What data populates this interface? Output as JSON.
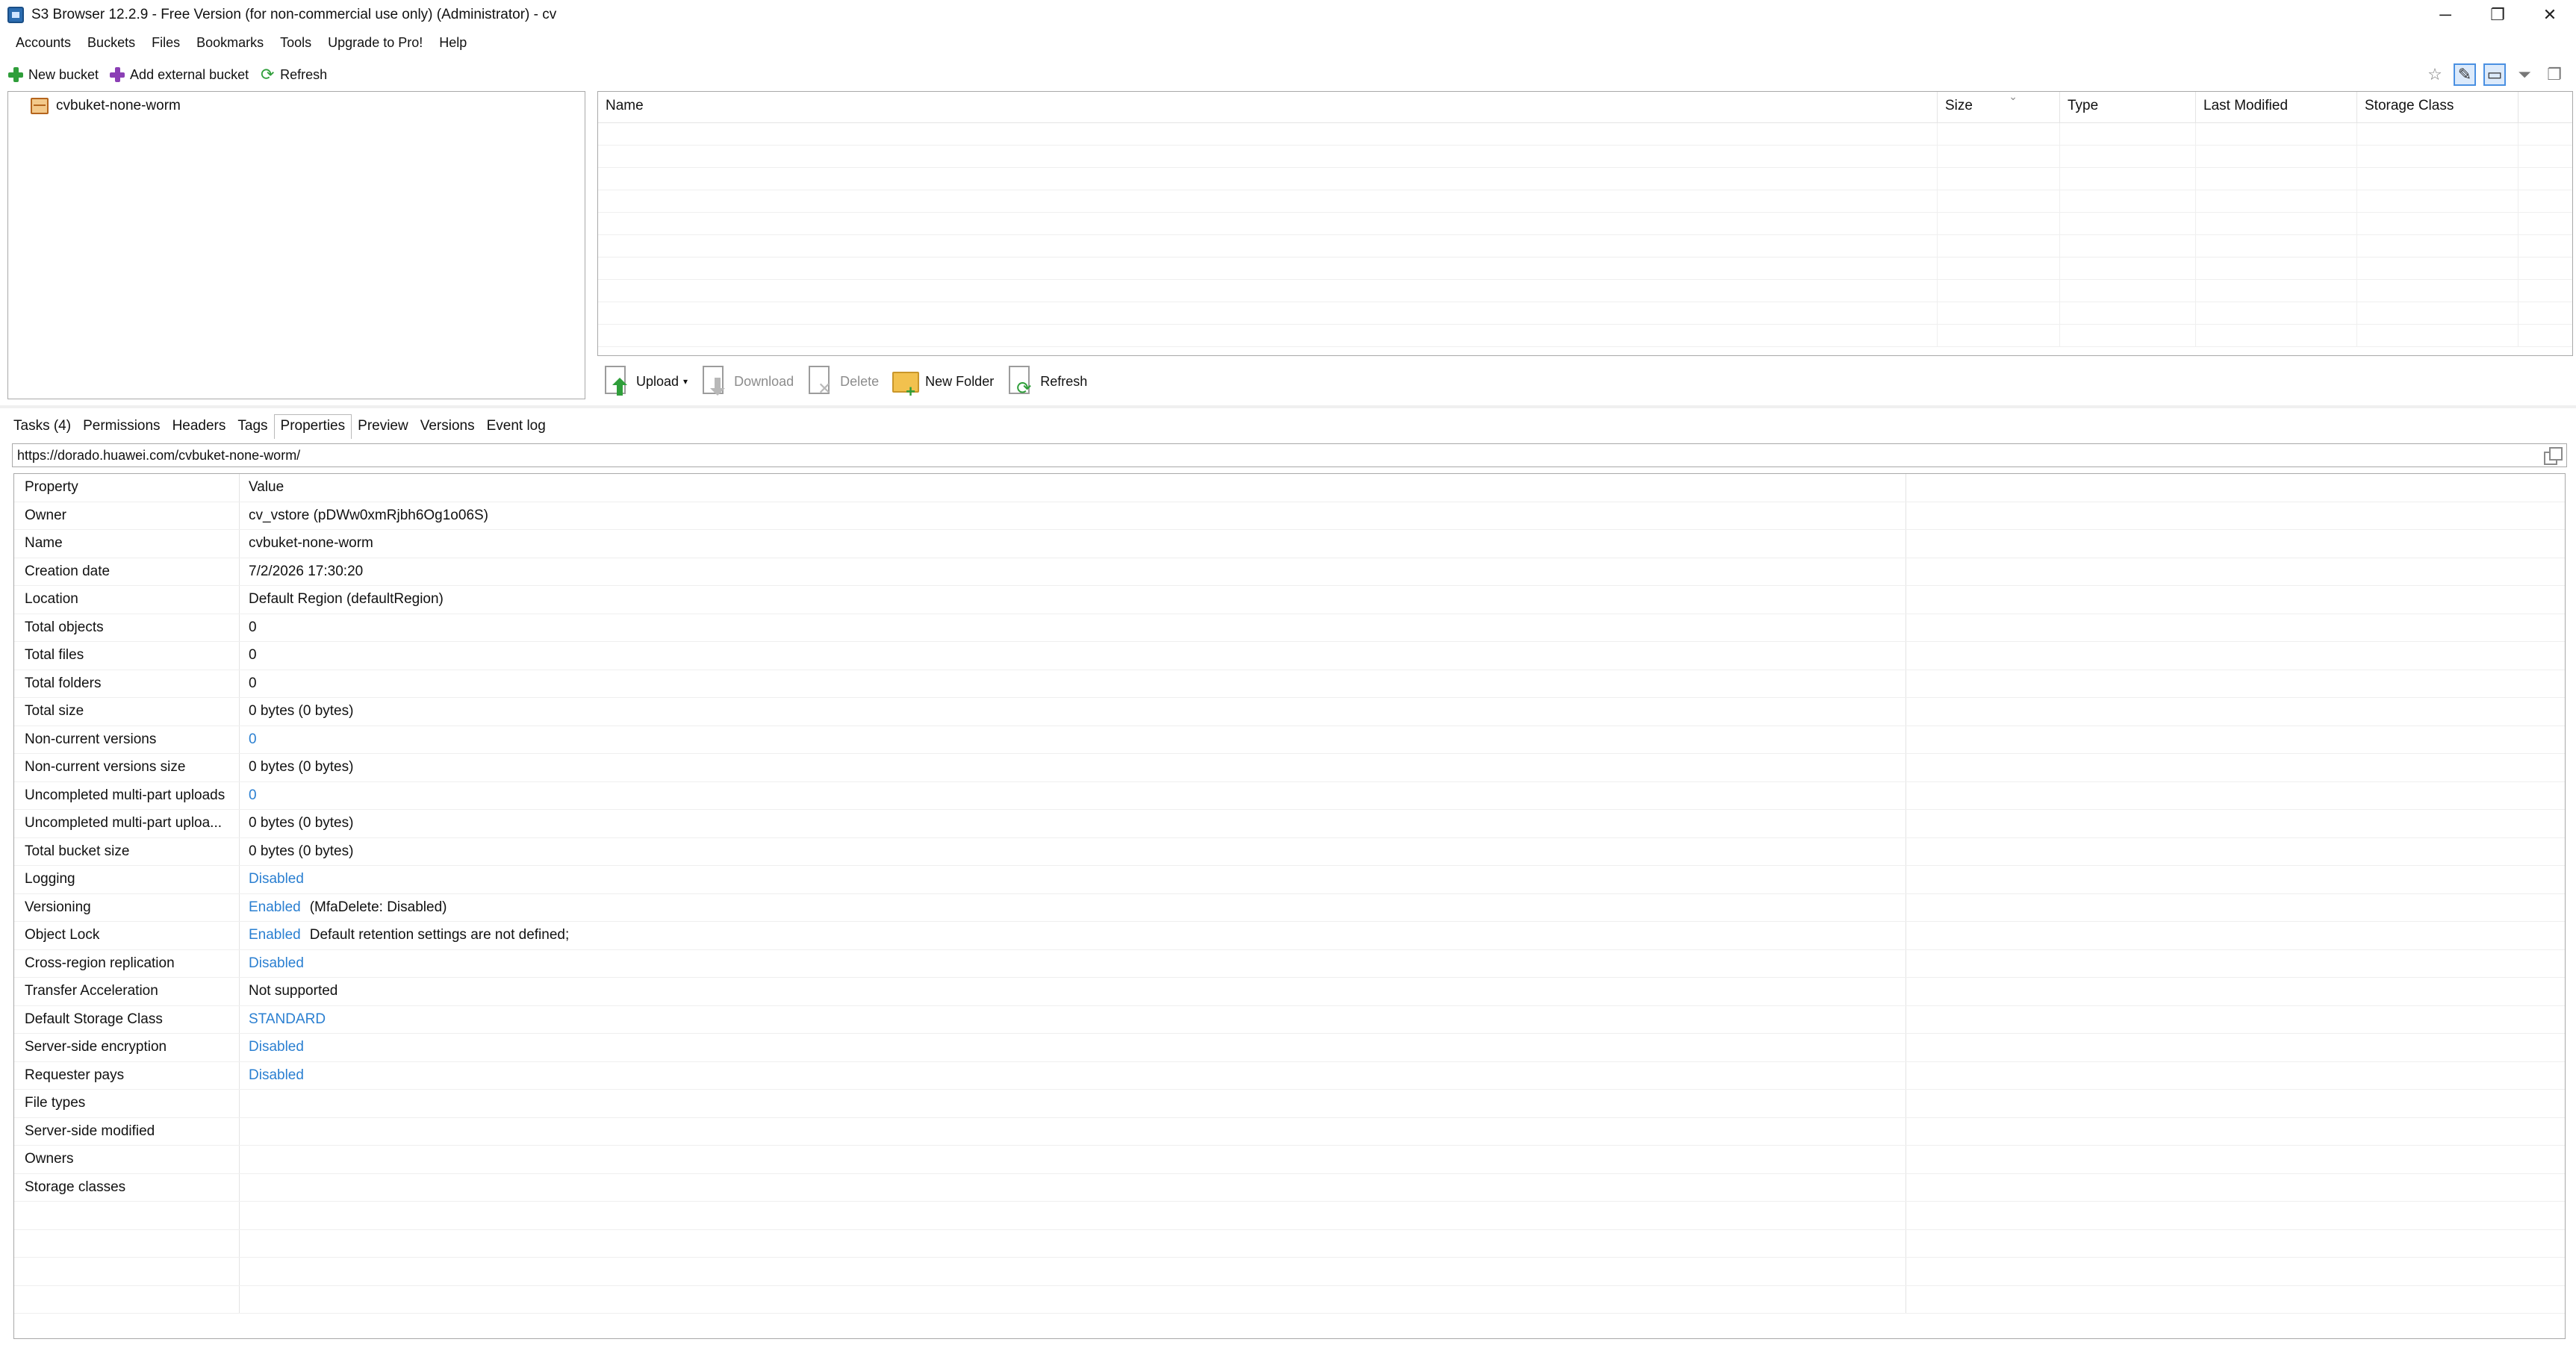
{
  "window": {
    "title": "S3 Browser 12.2.9 - Free Version (for non-commercial use only) (Administrator) - cv",
    "minimize": "─",
    "restore": "❐",
    "close": "✕"
  },
  "menu": [
    "Accounts",
    "Buckets",
    "Files",
    "Bookmarks",
    "Tools",
    "Upgrade to Pro!",
    "Help"
  ],
  "bucket_toolbar": {
    "new_bucket": "New bucket",
    "add_external": "Add external bucket",
    "refresh": "Refresh"
  },
  "bucket_tree": {
    "items": [
      "cvbuket-none-worm"
    ]
  },
  "file_list": {
    "columns": [
      "Name",
      "Size",
      "Type",
      "Last Modified",
      "Storage Class"
    ]
  },
  "file_toolbar": {
    "upload": "Upload",
    "download": "Download",
    "delete": "Delete",
    "new_folder": "New Folder",
    "refresh": "Refresh"
  },
  "tabs": [
    "Tasks (4)",
    "Permissions",
    "Headers",
    "Tags",
    "Properties",
    "Preview",
    "Versions",
    "Event log"
  ],
  "active_tab": "Properties",
  "url": "https://dorado.huawei.com/cvbuket-none-worm/",
  "properties": {
    "header": {
      "key": "Property",
      "value": "Value"
    },
    "rows": [
      {
        "key": "Owner",
        "value": "cv_vstore (pDWw0xmRjbh6Og1o06S)",
        "link": false
      },
      {
        "key": "Name",
        "value": "cvbuket-none-worm",
        "link": false
      },
      {
        "key": "Creation date",
        "value": "7/2/2026 17:30:20",
        "link": false
      },
      {
        "key": "Location",
        "value": "Default Region (defaultRegion)",
        "link": false
      },
      {
        "key": "Total objects",
        "value": "0",
        "link": false
      },
      {
        "key": "Total files",
        "value": "0",
        "link": false
      },
      {
        "key": "Total folders",
        "value": "0",
        "link": false
      },
      {
        "key": "Total size",
        "value": "0 bytes (0 bytes)",
        "link": false
      },
      {
        "key": "Non-current versions",
        "value": "0",
        "link": true
      },
      {
        "key": "Non-current versions size",
        "value": "0 bytes (0 bytes)",
        "link": false
      },
      {
        "key": "Uncompleted multi-part uploads",
        "value": "0",
        "link": true
      },
      {
        "key": "Uncompleted multi-part uploa...",
        "value": "0 bytes (0 bytes)",
        "link": false
      },
      {
        "key": "Total bucket size",
        "value": "0 bytes (0 bytes)",
        "link": false
      },
      {
        "key": "Logging",
        "value": "Disabled",
        "link": true
      },
      {
        "key": "Versioning",
        "value": "Enabled",
        "link": true,
        "note": "(MfaDelete: Disabled)"
      },
      {
        "key": "Object Lock",
        "value": "Enabled",
        "link": true,
        "note": "Default retention settings are not defined;"
      },
      {
        "key": "Cross-region replication",
        "value": "Disabled",
        "link": true
      },
      {
        "key": "Transfer Acceleration",
        "value": "Not supported",
        "link": false
      },
      {
        "key": "Default Storage Class",
        "value": "STANDARD",
        "link": true
      },
      {
        "key": "Server-side encryption",
        "value": "Disabled",
        "link": true
      },
      {
        "key": "Requester pays",
        "value": "Disabled",
        "link": true
      },
      {
        "key": "File types",
        "value": "",
        "link": false
      },
      {
        "key": "Server-side modified",
        "value": "",
        "link": false
      },
      {
        "key": "Owners",
        "value": "",
        "link": false
      },
      {
        "key": "Storage classes",
        "value": "",
        "link": false
      }
    ]
  },
  "colors": {
    "link": "#2a7fd1",
    "border": "#a9a9a9",
    "accent": "#4a90e2"
  }
}
